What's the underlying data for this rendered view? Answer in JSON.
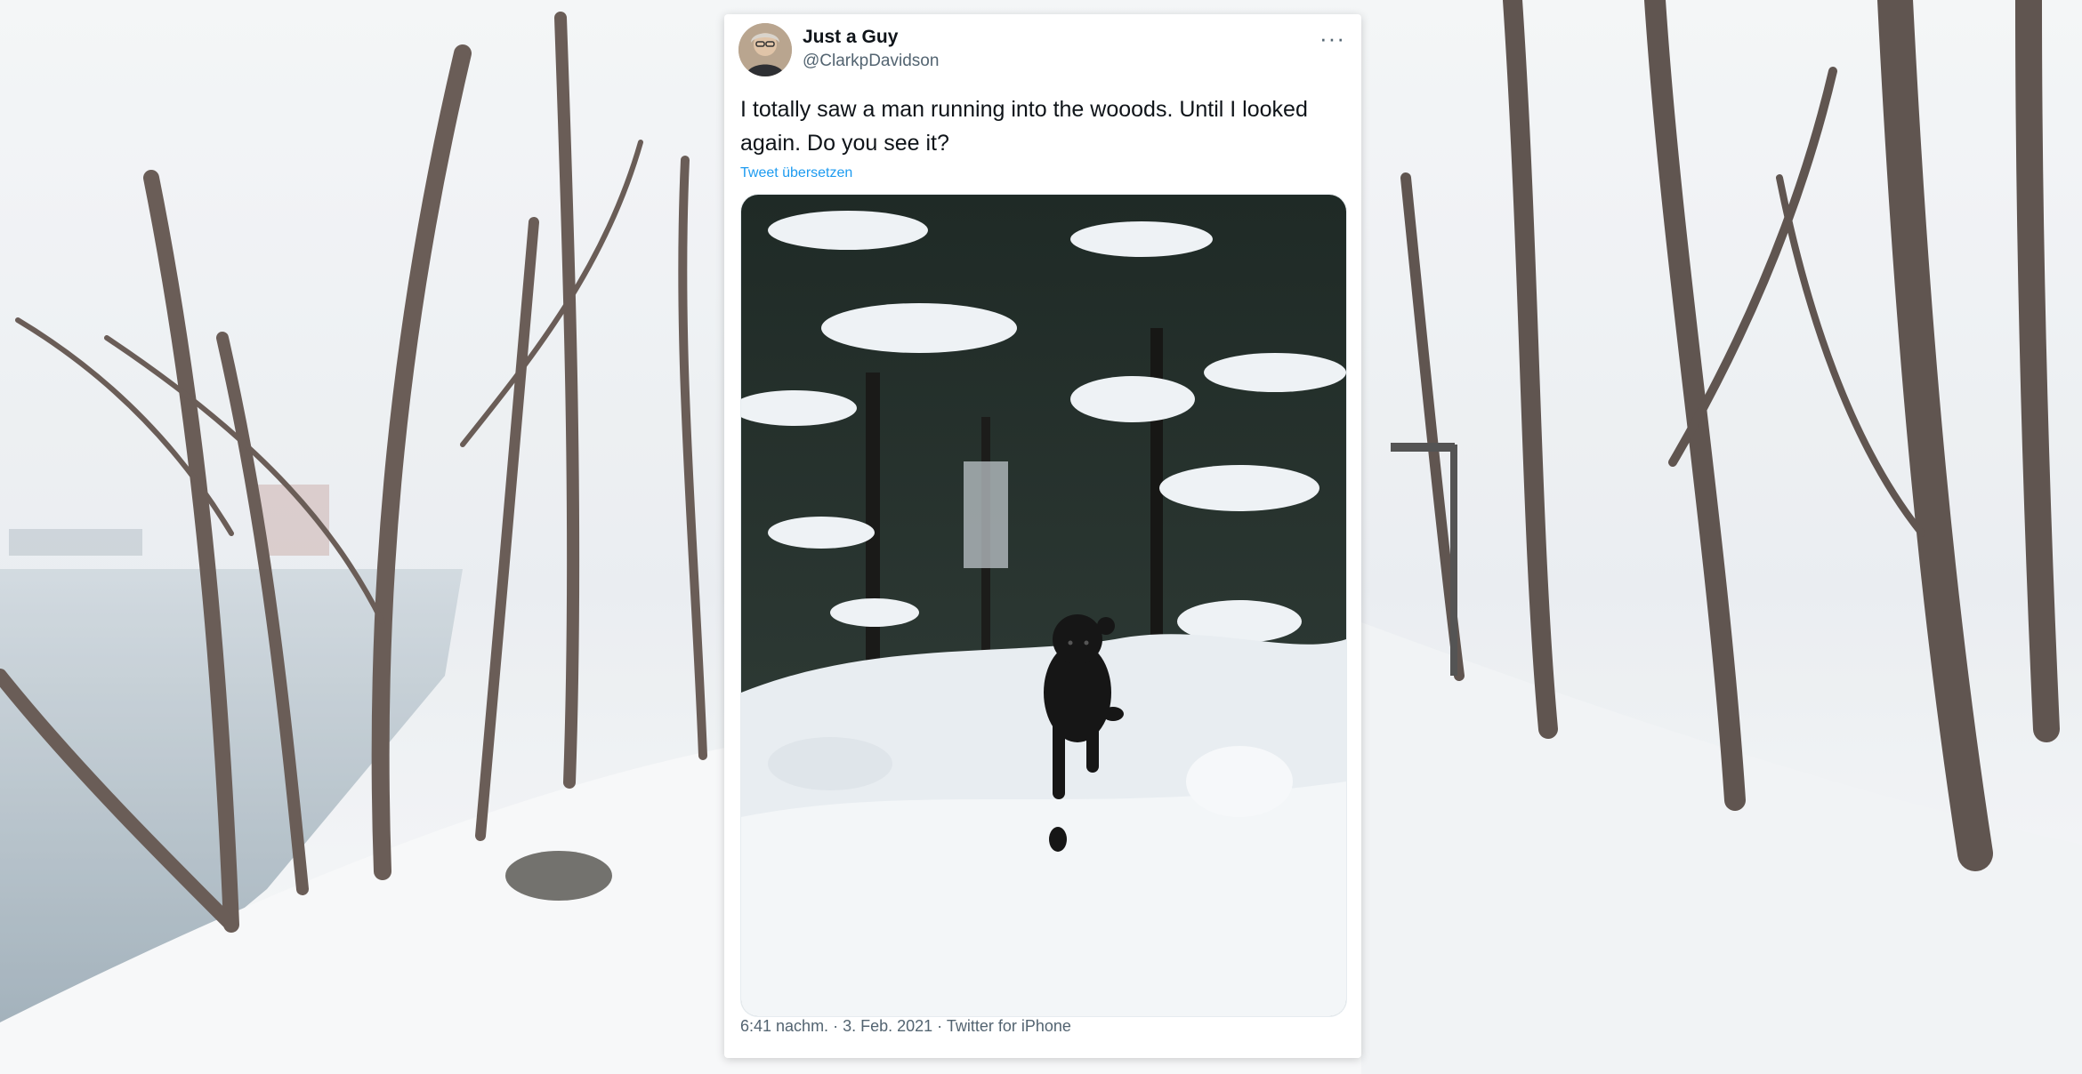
{
  "tweet": {
    "display_name": "Just a Guy",
    "handle": "@ClarkpDavidson",
    "more_icon": "more-horizontal-icon",
    "text": "I totally saw a man running into the wooods. Until I looked again. Do you see it?",
    "translate_link": "Tweet übersetzen",
    "time": "6:41 nachm.",
    "date": "3. Feb. 2021",
    "source": "Twitter for iPhone",
    "separator": " · "
  },
  "colors": {
    "link": "#1d9bf0",
    "text": "#0f1419",
    "muted": "#536471"
  }
}
